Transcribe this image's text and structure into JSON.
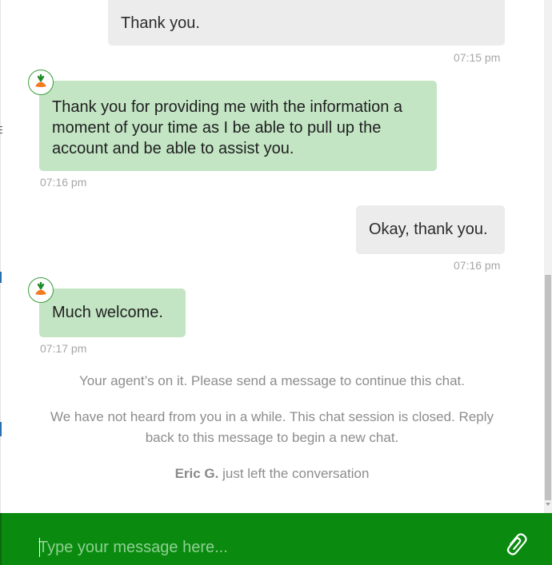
{
  "messages": [
    {
      "sender": "user",
      "text": "Thank you.",
      "time": "07:15 pm"
    },
    {
      "sender": "agent",
      "text": "Thank you for providing me with the information a moment of your time as I be able to pull up the account and be able to assist you.",
      "time": "07:16 pm"
    },
    {
      "sender": "user",
      "text": "Okay, thank you.",
      "time": "07:16 pm"
    },
    {
      "sender": "agent",
      "text": "Much welcome.",
      "time": "07:17 pm"
    }
  ],
  "system_notes": {
    "agent_on_it": "Your agent’s on it. Please send a message to continue this chat.",
    "session_closed": "We have not heard from you in a while. This chat session is closed. Reply back to this message to begin a new chat.",
    "left_name": "Eric G.",
    "left_text": " just left the conversation"
  },
  "composer": {
    "placeholder": "Type your message here...",
    "attach_icon": "paperclip-icon"
  },
  "avatar_icon": "carrot-icon",
  "colors": {
    "composer_bg": "#0a8a0f",
    "agent_bubble": "#c3e5c4",
    "user_bubble": "#ececec",
    "timestamp": "#a6a6a6"
  }
}
